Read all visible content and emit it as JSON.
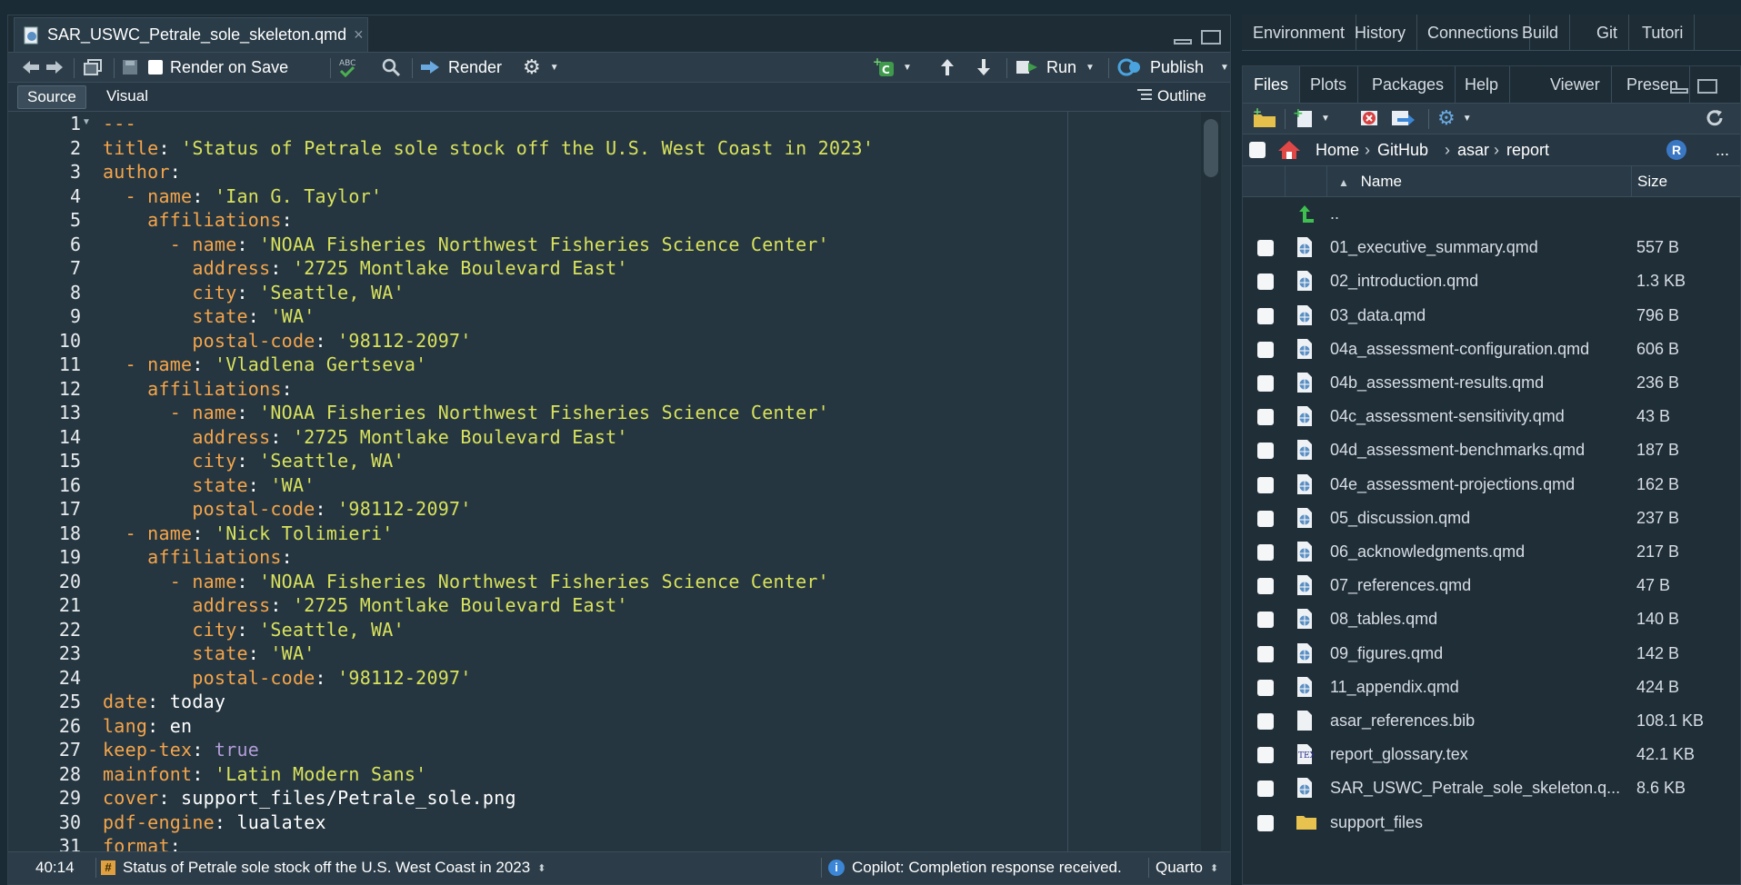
{
  "editor": {
    "tab_label": "SAR_USWC_Petrale_sole_skeleton.qmd",
    "tab_close": "×",
    "toolbar": {
      "render_on_save": "Render on Save",
      "render": "Render",
      "run": "Run",
      "publish": "Publish"
    },
    "modes": {
      "source": "Source",
      "visual": "Visual",
      "outline": "Outline"
    },
    "line_numbers": [
      "1",
      "2",
      "3",
      "4",
      "5",
      "6",
      "7",
      "8",
      "9",
      "10",
      "11",
      "12",
      "13",
      "14",
      "15",
      "16",
      "17",
      "18",
      "19",
      "20",
      "21",
      "22",
      "23",
      "24",
      "25",
      "26",
      "27",
      "28",
      "29",
      "30",
      "31"
    ],
    "code_lines": [
      [
        {
          "t": "---",
          "c": "d"
        }
      ],
      [
        {
          "t": "title",
          "c": "k"
        },
        {
          "t": ": ",
          "c": "p"
        },
        {
          "t": "'Status of Petrale sole stock off the U.S. West Coast in 2023'",
          "c": "s"
        }
      ],
      [
        {
          "t": "author",
          "c": "k"
        },
        {
          "t": ":",
          "c": "p"
        }
      ],
      [
        {
          "t": "  - ",
          "c": "k"
        },
        {
          "t": "name",
          "c": "k"
        },
        {
          "t": ": ",
          "c": "p"
        },
        {
          "t": "'Ian G. Taylor'",
          "c": "s"
        }
      ],
      [
        {
          "t": "    affiliations",
          "c": "k"
        },
        {
          "t": ":",
          "c": "p"
        }
      ],
      [
        {
          "t": "      - ",
          "c": "k"
        },
        {
          "t": "name",
          "c": "k"
        },
        {
          "t": ": ",
          "c": "p"
        },
        {
          "t": "'NOAA Fisheries Northwest Fisheries Science Center'",
          "c": "s"
        }
      ],
      [
        {
          "t": "        address",
          "c": "k"
        },
        {
          "t": ": ",
          "c": "p"
        },
        {
          "t": "'2725 Montlake Boulevard East'",
          "c": "s"
        }
      ],
      [
        {
          "t": "        city",
          "c": "k"
        },
        {
          "t": ": ",
          "c": "p"
        },
        {
          "t": "'Seattle, WA'",
          "c": "s"
        }
      ],
      [
        {
          "t": "        state",
          "c": "k"
        },
        {
          "t": ": ",
          "c": "p"
        },
        {
          "t": "'WA'",
          "c": "s"
        }
      ],
      [
        {
          "t": "        postal-code",
          "c": "k"
        },
        {
          "t": ": ",
          "c": "p"
        },
        {
          "t": "'98112-2097'",
          "c": "s"
        }
      ],
      [
        {
          "t": "  - ",
          "c": "k"
        },
        {
          "t": "name",
          "c": "k"
        },
        {
          "t": ": ",
          "c": "p"
        },
        {
          "t": "'Vladlena Gertseva'",
          "c": "s"
        }
      ],
      [
        {
          "t": "    affiliations",
          "c": "k"
        },
        {
          "t": ":",
          "c": "p"
        }
      ],
      [
        {
          "t": "      - ",
          "c": "k"
        },
        {
          "t": "name",
          "c": "k"
        },
        {
          "t": ": ",
          "c": "p"
        },
        {
          "t": "'NOAA Fisheries Northwest Fisheries Science Center'",
          "c": "s"
        }
      ],
      [
        {
          "t": "        address",
          "c": "k"
        },
        {
          "t": ": ",
          "c": "p"
        },
        {
          "t": "'2725 Montlake Boulevard East'",
          "c": "s"
        }
      ],
      [
        {
          "t": "        city",
          "c": "k"
        },
        {
          "t": ": ",
          "c": "p"
        },
        {
          "t": "'Seattle, WA'",
          "c": "s"
        }
      ],
      [
        {
          "t": "        state",
          "c": "k"
        },
        {
          "t": ": ",
          "c": "p"
        },
        {
          "t": "'WA'",
          "c": "s"
        }
      ],
      [
        {
          "t": "        postal-code",
          "c": "k"
        },
        {
          "t": ": ",
          "c": "p"
        },
        {
          "t": "'98112-2097'",
          "c": "s"
        }
      ],
      [
        {
          "t": "  - ",
          "c": "k"
        },
        {
          "t": "name",
          "c": "k"
        },
        {
          "t": ": ",
          "c": "p"
        },
        {
          "t": "'Nick Tolimieri'",
          "c": "s"
        }
      ],
      [
        {
          "t": "    affiliations",
          "c": "k"
        },
        {
          "t": ":",
          "c": "p"
        }
      ],
      [
        {
          "t": "      - ",
          "c": "k"
        },
        {
          "t": "name",
          "c": "k"
        },
        {
          "t": ": ",
          "c": "p"
        },
        {
          "t": "'NOAA Fisheries Northwest Fisheries Science Center'",
          "c": "s"
        }
      ],
      [
        {
          "t": "        address",
          "c": "k"
        },
        {
          "t": ": ",
          "c": "p"
        },
        {
          "t": "'2725 Montlake Boulevard East'",
          "c": "s"
        }
      ],
      [
        {
          "t": "        city",
          "c": "k"
        },
        {
          "t": ": ",
          "c": "p"
        },
        {
          "t": "'Seattle, WA'",
          "c": "s"
        }
      ],
      [
        {
          "t": "        state",
          "c": "k"
        },
        {
          "t": ": ",
          "c": "p"
        },
        {
          "t": "'WA'",
          "c": "s"
        }
      ],
      [
        {
          "t": "        postal-code",
          "c": "k"
        },
        {
          "t": ": ",
          "c": "p"
        },
        {
          "t": "'98112-2097'",
          "c": "s"
        }
      ],
      [
        {
          "t": "date",
          "c": "k"
        },
        {
          "t": ": today",
          "c": "p"
        }
      ],
      [
        {
          "t": "lang",
          "c": "k"
        },
        {
          "t": ": en",
          "c": "p"
        }
      ],
      [
        {
          "t": "keep-tex",
          "c": "k"
        },
        {
          "t": ": ",
          "c": "p"
        },
        {
          "t": "true",
          "c": "b"
        }
      ],
      [
        {
          "t": "mainfont",
          "c": "k"
        },
        {
          "t": ": ",
          "c": "p"
        },
        {
          "t": "'Latin Modern Sans'",
          "c": "s"
        }
      ],
      [
        {
          "t": "cover",
          "c": "k"
        },
        {
          "t": ": support_files/Petrale_sole.png",
          "c": "p"
        }
      ],
      [
        {
          "t": "pdf-engine",
          "c": "k"
        },
        {
          "t": ": lualatex",
          "c": "p"
        }
      ],
      [
        {
          "t": "format",
          "c": "k"
        },
        {
          "t": ":",
          "c": "p"
        }
      ]
    ],
    "status": {
      "position": "40:14",
      "section": "Status of Petrale sole stock off the U.S. West Coast in 2023",
      "copilot": "Copilot: Completion response received.",
      "filetype": "Quarto"
    }
  },
  "right_top_tabs": [
    "Environment",
    "History",
    "Connections",
    "Build",
    "Git",
    "Tutori"
  ],
  "files_tabs": [
    "Files",
    "Plots",
    "Packages",
    "Help",
    "Viewer",
    "Presen"
  ],
  "breadcrumb": [
    "Home",
    "GitHub",
    "asar",
    "report"
  ],
  "more_label": "...",
  "file_header": {
    "name": "Name",
    "size": "Size",
    "sort_arrow": "▲"
  },
  "parent_dir": "..",
  "files": [
    {
      "name": "01_executive_summary.qmd",
      "size": "557 B",
      "icon": "qmd"
    },
    {
      "name": "02_introduction.qmd",
      "size": "1.3 KB",
      "icon": "qmd"
    },
    {
      "name": "03_data.qmd",
      "size": "796 B",
      "icon": "qmd"
    },
    {
      "name": "04a_assessment-configuration.qmd",
      "size": "606 B",
      "icon": "qmd"
    },
    {
      "name": "04b_assessment-results.qmd",
      "size": "236 B",
      "icon": "qmd"
    },
    {
      "name": "04c_assessment-sensitivity.qmd",
      "size": "43 B",
      "icon": "qmd"
    },
    {
      "name": "04d_assessment-benchmarks.qmd",
      "size": "187 B",
      "icon": "qmd"
    },
    {
      "name": "04e_assessment-projections.qmd",
      "size": "162 B",
      "icon": "qmd"
    },
    {
      "name": "05_discussion.qmd",
      "size": "237 B",
      "icon": "qmd"
    },
    {
      "name": "06_acknowledgments.qmd",
      "size": "217 B",
      "icon": "qmd"
    },
    {
      "name": "07_references.qmd",
      "size": "47 B",
      "icon": "qmd"
    },
    {
      "name": "08_tables.qmd",
      "size": "140 B",
      "icon": "qmd"
    },
    {
      "name": "09_figures.qmd",
      "size": "142 B",
      "icon": "qmd"
    },
    {
      "name": "11_appendix.qmd",
      "size": "424 B",
      "icon": "qmd"
    },
    {
      "name": "asar_references.bib",
      "size": "108.1 KB",
      "icon": "blank"
    },
    {
      "name": "report_glossary.tex",
      "size": "42.1 KB",
      "icon": "tex"
    },
    {
      "name": "SAR_USWC_Petrale_sole_skeleton.q...",
      "size": "8.6 KB",
      "icon": "qmd"
    },
    {
      "name": "support_files",
      "size": "",
      "icon": "folder"
    }
  ]
}
